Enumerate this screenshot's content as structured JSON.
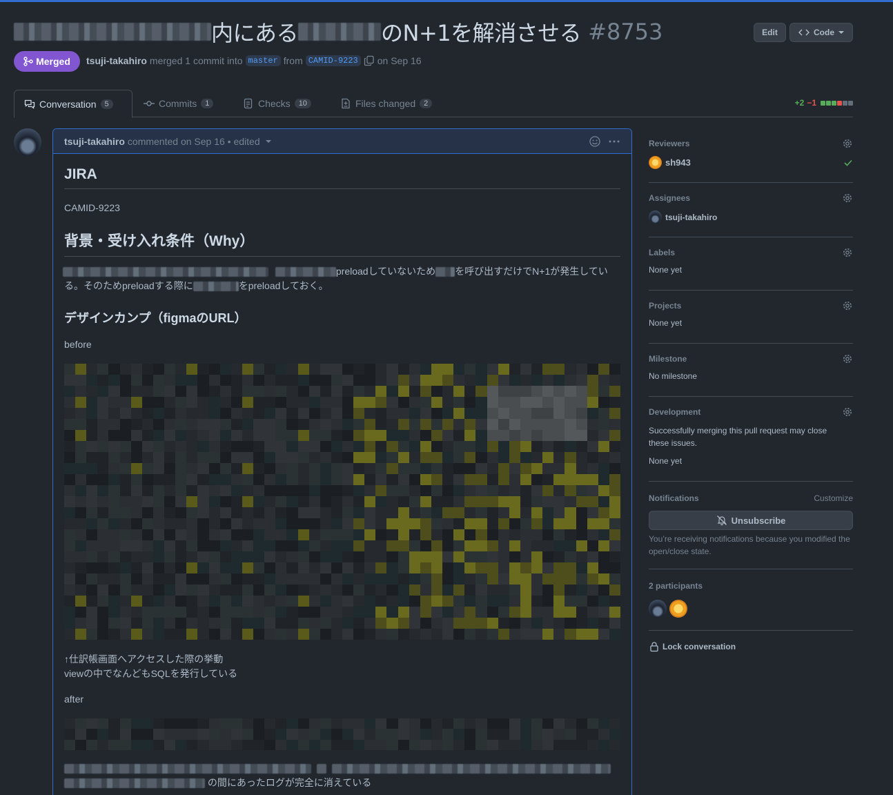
{
  "pr": {
    "title_tail": "のN+1を解消させる",
    "title_mid": "内にある",
    "number": "#8753",
    "edit_label": "Edit",
    "code_label": "Code",
    "state_label": "Merged",
    "author": "tsuji-takahiro",
    "merge_text": "merged 1 commit into",
    "base_branch": "master",
    "from_text": "from",
    "head_branch": "CAMID-9223",
    "date_text": "on Sep 16"
  },
  "tabs": [
    {
      "label": "Conversation",
      "count": "5"
    },
    {
      "label": "Commits",
      "count": "1"
    },
    {
      "label": "Checks",
      "count": "10"
    },
    {
      "label": "Files changed",
      "count": "2"
    }
  ],
  "diffstat": {
    "added": "+2",
    "removed": "−1",
    "colors": [
      "#57ab5a",
      "#57ab5a",
      "#57ab5a",
      "#e5534b",
      "#636e7b",
      "#636e7b"
    ]
  },
  "comment": {
    "author": "tsuji-takahiro",
    "meta": "commented on Sep 16 • edited",
    "h_jira": "JIRA",
    "jira_link": "CAMID-9223",
    "h_why": "背景・受け入れ条件（Why）",
    "why_1a": "preloadしていないため",
    "why_1b": "を呼び出すだけでN+1が発生してい",
    "why_2a": "る。そのためpreloadする際に",
    "why_2b": "をpreloadしておく。",
    "h_design": "デザインカンプ（figmaのURL）",
    "before": "before",
    "note_1": "↑仕訳帳画面へアクセスした際の挙動",
    "note_2": "viewの中でなんどもSQLを発行している",
    "after": "after",
    "last_line": "の間にあったログが完全に消えている"
  },
  "sidebar": {
    "reviewers": {
      "heading": "Reviewers",
      "name": "sh943"
    },
    "assignees": {
      "heading": "Assignees",
      "name": "tsuji-takahiro"
    },
    "labels": {
      "heading": "Labels",
      "value": "None yet"
    },
    "projects": {
      "heading": "Projects",
      "value": "None yet"
    },
    "milestone": {
      "heading": "Milestone",
      "value": "No milestone"
    },
    "development": {
      "heading": "Development",
      "text": "Successfully merging this pull request may close these issues.",
      "value": "None yet"
    },
    "notifications": {
      "heading": "Notifications",
      "customize": "Customize",
      "button": "Unsubscribe",
      "note": "You’re receiving notifications because you modified the open/close state."
    },
    "participants": {
      "heading": "2 participants"
    },
    "lock": "Lock conversation"
  },
  "colors": {
    "accent": "#316dca",
    "merged": "#8256d0",
    "link": "#539bf5",
    "success": "#57ab5a",
    "danger": "#e5534b"
  }
}
